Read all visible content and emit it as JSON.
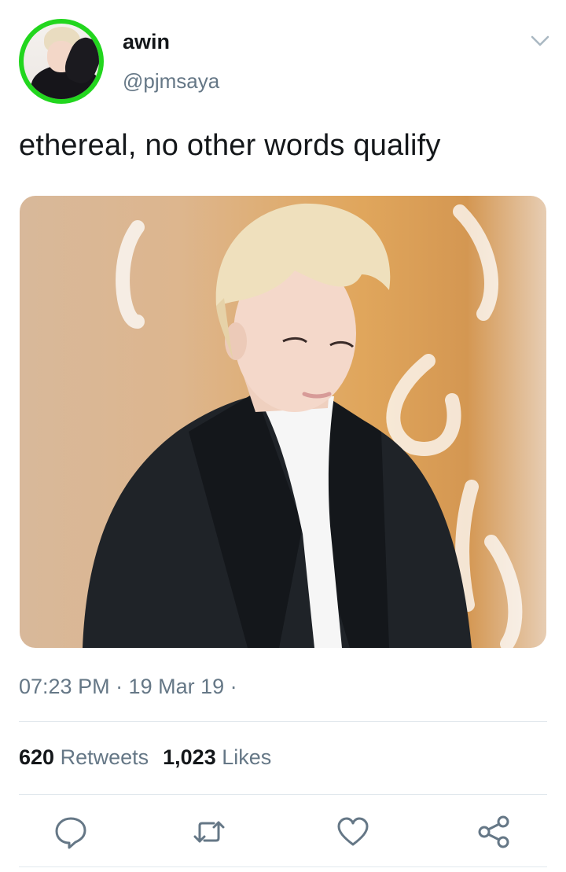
{
  "user": {
    "name": "awin",
    "handle": "@pjmsaya"
  },
  "tweet": {
    "text": "ethereal, no other words qualify",
    "timestamp": "07:23 PM · 19 Mar 19 ·"
  },
  "stats": {
    "retweets_count": "620",
    "retweets_label": "Retweets",
    "likes_count": "1,023",
    "likes_label": "Likes"
  },
  "actions": [
    "reply-icon",
    "retweet-icon",
    "like-icon",
    "share-icon"
  ],
  "colors": {
    "text": "#14171a",
    "secondary": "#657786",
    "avatar_ring": "#22d61e",
    "divider": "#e1e8ed"
  }
}
